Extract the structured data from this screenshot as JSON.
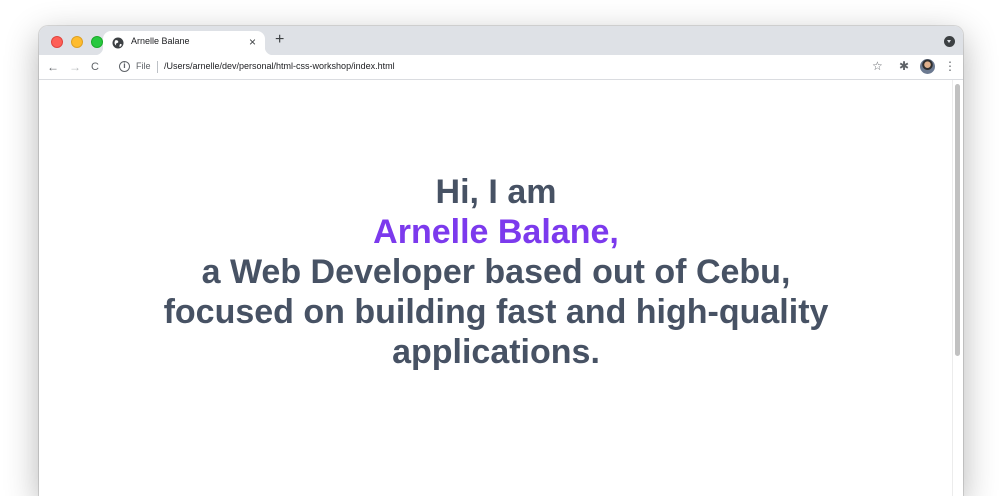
{
  "browser": {
    "tab": {
      "title": "Arnelle Balane",
      "favicon": "globe-icon",
      "close_glyph": "×"
    },
    "new_tab_glyph": "+",
    "toolbar": {
      "back_glyph": "←",
      "forward_glyph": "→",
      "reload_glyph": "C",
      "info_glyph": "i",
      "scheme_label": "File",
      "url": "/Users/arnelle/dev/personal/html-css-workshop/index.html",
      "star_glyph": "☆",
      "extensions_glyph": "✱",
      "menu_glyph": "⋮"
    }
  },
  "page": {
    "line1": "Hi, I am",
    "name": "Arnelle Balane,",
    "line3": "a Web Developer based out of Cebu,",
    "line4": "focused on building fast and high-quality",
    "line5": "applications."
  },
  "colors": {
    "text": "#475264",
    "accent": "#7c3aed",
    "tabstrip": "#dee1e6"
  }
}
